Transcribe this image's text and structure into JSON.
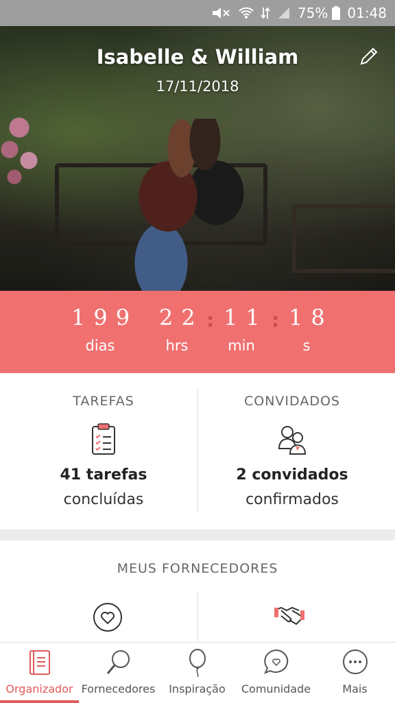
{
  "status_bar": {
    "battery": "75%",
    "time": "01:48"
  },
  "header": {
    "couple_names": "Isabelle & William",
    "wedding_date": "17/11/2018"
  },
  "countdown": {
    "days": "199",
    "hours": "22",
    "minutes": "11",
    "seconds": "18",
    "days_label": "dias",
    "hours_label": "hrs",
    "minutes_label": "min",
    "seconds_label": "s",
    "separator": ":"
  },
  "stats": {
    "tasks": {
      "title": "TAREFAS",
      "value": "41 tarefas",
      "sub": "concluídas"
    },
    "guests": {
      "title": "CONVIDADOS",
      "value": "2 convidados",
      "sub": "confirmados"
    }
  },
  "vendors": {
    "title": "MEUS FORNECEDORES"
  },
  "bottom_nav": [
    {
      "label": "Organizador",
      "icon": "notebook-icon",
      "active": true
    },
    {
      "label": "Fornecedores",
      "icon": "search-icon",
      "active": false
    },
    {
      "label": "Inspiração",
      "icon": "balloon-icon",
      "active": false
    },
    {
      "label": "Comunidade",
      "icon": "chat-heart-icon",
      "active": false
    },
    {
      "label": "Mais",
      "icon": "more-icon",
      "active": false
    }
  ],
  "colors": {
    "accent": "#f07070",
    "active_tab": "#e05a5a",
    "status_bar": "#9e9e9e"
  }
}
